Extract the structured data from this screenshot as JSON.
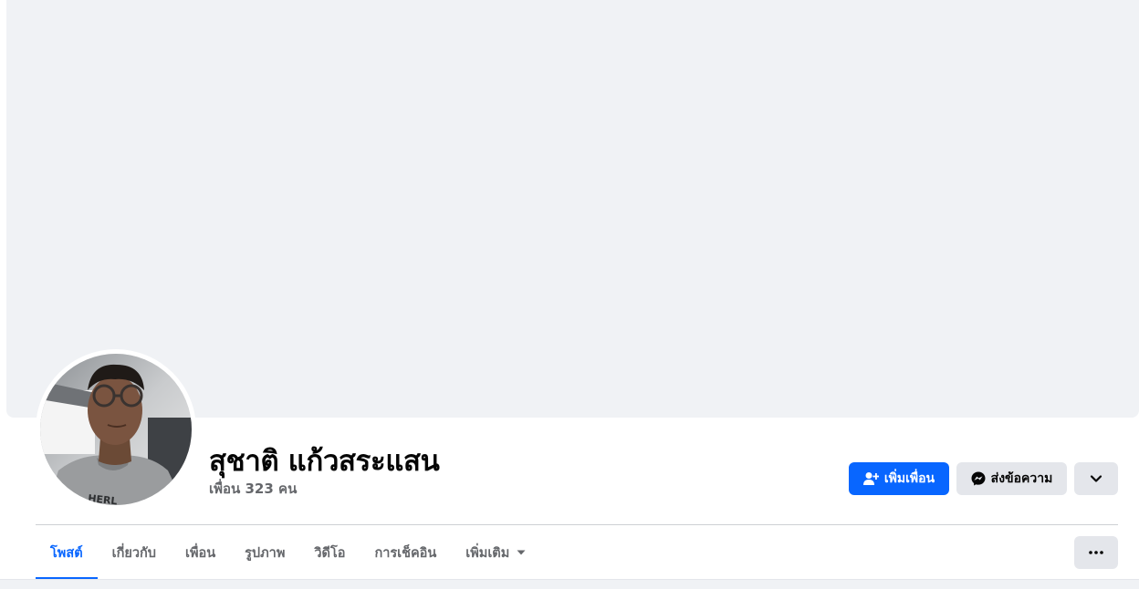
{
  "profile": {
    "name": "สุชาติ แก้วสระแสน",
    "friends_count_text": "เพื่อน 323 คน"
  },
  "actions": {
    "add_friend_label": "เพิ่มเพื่อน",
    "add_friend_icon": "person-add-icon",
    "message_label": "ส่งข้อความ",
    "message_icon": "messenger-icon",
    "more_icon": "chevron-down-icon"
  },
  "tabs": [
    {
      "label": "โพสต์",
      "active": true
    },
    {
      "label": "เกี่ยวกับ",
      "active": false
    },
    {
      "label": "เพื่อน",
      "active": false
    },
    {
      "label": "รูปภาพ",
      "active": false
    },
    {
      "label": "วิดีโอ",
      "active": false
    },
    {
      "label": "การเช็คอิน",
      "active": false
    },
    {
      "label": "เพิ่มเติม",
      "active": false,
      "icon": "caret-down-icon"
    }
  ],
  "tab_options_icon": "ellipsis-icon",
  "colors": {
    "accent": "#0866ff",
    "cover": "#f0f2f5",
    "secondary_button": "#e4e6eb",
    "muted_text": "#65676b"
  }
}
